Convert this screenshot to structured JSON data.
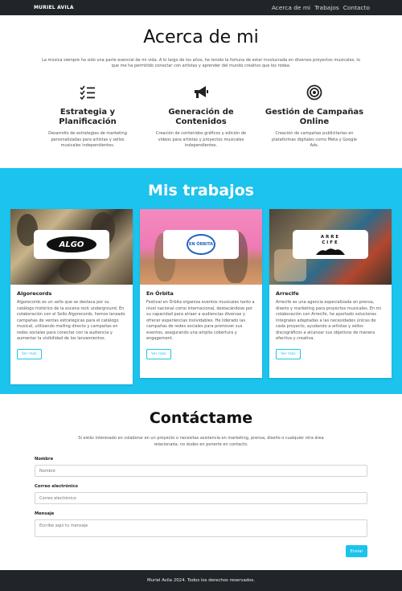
{
  "nav": {
    "brand": "MURIEL AVILA",
    "links": [
      "Acerca de mi",
      "Trabajos",
      "Contacto"
    ]
  },
  "about": {
    "title": "Acerca de mi",
    "intro": "La música siempre ha sido una parte esencial de mi vida. A lo largo de los años, he tenido la fortuna de estar involucrada en diversos proyectos musicales, lo que me ha permitido conectar con artistas y aprender del mundo creativo que los rodea.",
    "services": [
      {
        "icon": "checklist-icon",
        "title": "Estrategia y Planificación",
        "desc": "Desarrollo de estrategias de marketing personalizadas para artistas y sellos musicales independientes."
      },
      {
        "icon": "megaphone-icon",
        "title": "Generación de Contenidos",
        "desc": "Creación de contenidos gráficos y edición de videos para artistas y proyectos musicales independientes."
      },
      {
        "icon": "target-icon",
        "title": "Gestión de Campañas Online",
        "desc": "Creación de campañas publicitarias en plataformas digitales como Meta y Google Ads."
      }
    ]
  },
  "works": {
    "title": "Mis trabajos",
    "cards": [
      {
        "logo": "ALGO",
        "title": "Algorecords",
        "text": "Algorecords es un sello que se destaca por su catálogo histórico de la escena rock underground. En colaboración con el Sello Algorecords, hemos lanzado campañas de ventas estratégicas para el catálogo musical, utilizando mailing directo y campañas en redes sociales para conectar con la audiencia y aumentar la visibilidad de los lanzamientos.",
        "button": "Ver más"
      },
      {
        "logo": "EN ÓRBITA",
        "title": "En Órbita",
        "text": "Festival en Órbita organiza eventos musicales tanto a nivel nacional como internacional, destacándose por su capacidad para atraer a audiencias diversas y ofrecer experiencias inolvidables. He liderado las campañas de redes sociales para promover sus eventos, asegurando una amplia cobertura y engagement.",
        "button": "Ver más"
      },
      {
        "logo": "ARRE CIFE",
        "title": "Arrecife",
        "text": "Arrecife es una agencia especializada en prensa, diseño y marketing para proyectos musicales. En mi colaboración con Arrecife, he aportado soluciones integrales adaptadas a las necesidades únicas de cada proyecto, ayudando a artistas y sellos discográficos a alcanzar sus objetivos de manera efectiva y creativa.",
        "button": "Ver más"
      }
    ]
  },
  "contact": {
    "title": "Contáctame",
    "intro": "Si estás interesado en colaborar en un proyecto o necesitas asistencia en marketing, prensa, diseño o cualquier otra área relacionada, no dudes en ponerte en contacto.",
    "name_label": "Nombre",
    "name_placeholder": "Nombre",
    "email_label": "Correo electrónico",
    "email_placeholder": "Correo electrónico",
    "message_label": "Mensaje",
    "message_placeholder": "Escribe aquí tu mensaje",
    "submit": "Enviar"
  },
  "footer": {
    "text": "Muriel Avila 2024. Todos los derechos reservados."
  },
  "colors": {
    "accent": "#1cc3ec",
    "dark": "#212529"
  }
}
